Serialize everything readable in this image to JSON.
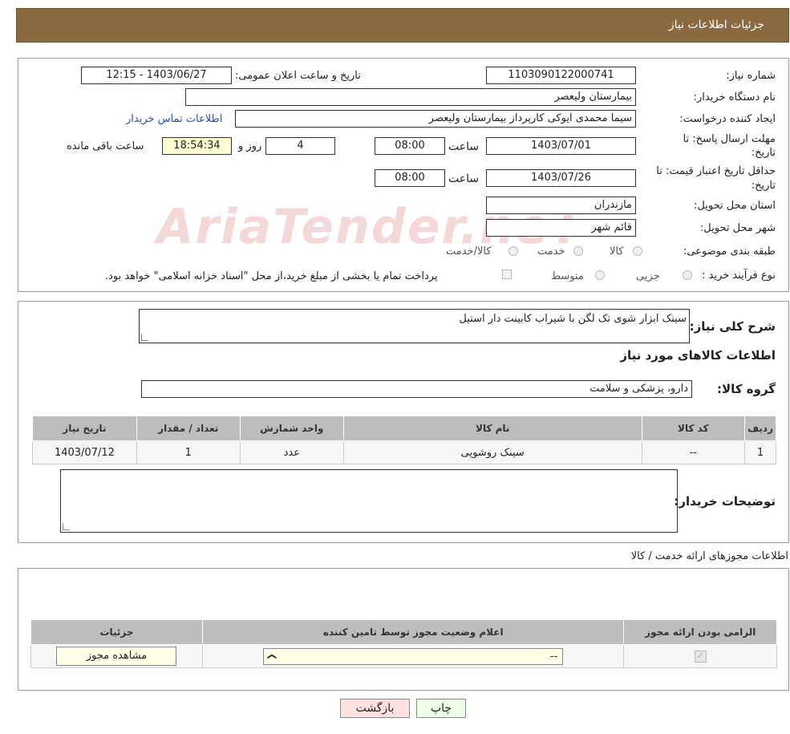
{
  "header": {
    "title": "جزئیات اطلاعات نیاز"
  },
  "watermark": "AriaTender.neT",
  "form": {
    "need_number_label": "شماره نیاز:",
    "need_number": "1103090122000741",
    "announce_label": "تاریخ و ساعت اعلان عمومی:",
    "announce_value": "1403/06/27 - 12:15",
    "buyer_org_label": "نام دستگاه خریدار:",
    "buyer_org": "بیمارستان ولیعصر",
    "creator_label": "ایجاد کننده درخواست:",
    "creator": "سیما محمدی ایوکی کارپرداز بیمارستان ولیعصر",
    "contact_link": "اطلاعات تماس خریدار",
    "deadline_label_1": "مهلت ارسال پاسخ: تا",
    "deadline_label_2": "تاریخ:",
    "deadline_date": "1403/07/01",
    "time_label": "ساعت",
    "deadline_time": "08:00",
    "days_value": "4",
    "days_label": "روز و",
    "remaining_time": "18:54:34",
    "remaining_label": "ساعت باقی مانده",
    "validity_label_1": "حداقل تاریخ اعتبار قیمت: تا",
    "validity_label_2": "تاریخ:",
    "validity_date": "1403/07/26",
    "validity_time": "08:00",
    "province_label": "استان محل تحویل:",
    "province": "مازندران",
    "city_label": "شهر محل تحویل:",
    "city": "قائم شهر",
    "category_label": "طبقه بندی موضوعی:",
    "category_options": [
      "کالا",
      "خدمت",
      "کالا/خدمت"
    ],
    "process_label": "نوع فرآیند خرید :",
    "process_options": [
      "جزیی",
      "متوسط"
    ],
    "process_note": "پرداخت تمام یا بخشی از مبلغ خرید،از محل \"اسناد خزانه اسلامی\" خواهد بود."
  },
  "details": {
    "summary_label": "شرح کلی نیاز:",
    "summary_value": "سینک ابزار شوی تک لگن با شیراب کابینت دار استیل",
    "goods_info_title": "اطلاعات کالاهای مورد نیاز",
    "goods_group_label": "گروه کالا:",
    "goods_group": "دارو، پزشکی و سلامت",
    "table_headers": [
      "ردیف",
      "کد کالا",
      "نام کالا",
      "واحد شمارش",
      "تعداد / مقدار",
      "تاریخ نیاز"
    ],
    "table_rows": [
      [
        "1",
        "--",
        "سینک روشویی",
        "عدد",
        "1",
        "1403/07/12"
      ]
    ],
    "buyer_notes_label": "توضیحات خریدار:"
  },
  "licenses": {
    "title": "اطلاعات مجوزهای ارائه خدمت / کالا",
    "headers": [
      "الزامی بودن ارائه مجوز",
      "اعلام وضعیت مجوز توسط تامین کننده",
      "جزئیات"
    ],
    "select_value": "--",
    "view_button": "مشاهده مجوز"
  },
  "footer": {
    "print_button": "چاپ",
    "back_button": "بازگشت"
  }
}
